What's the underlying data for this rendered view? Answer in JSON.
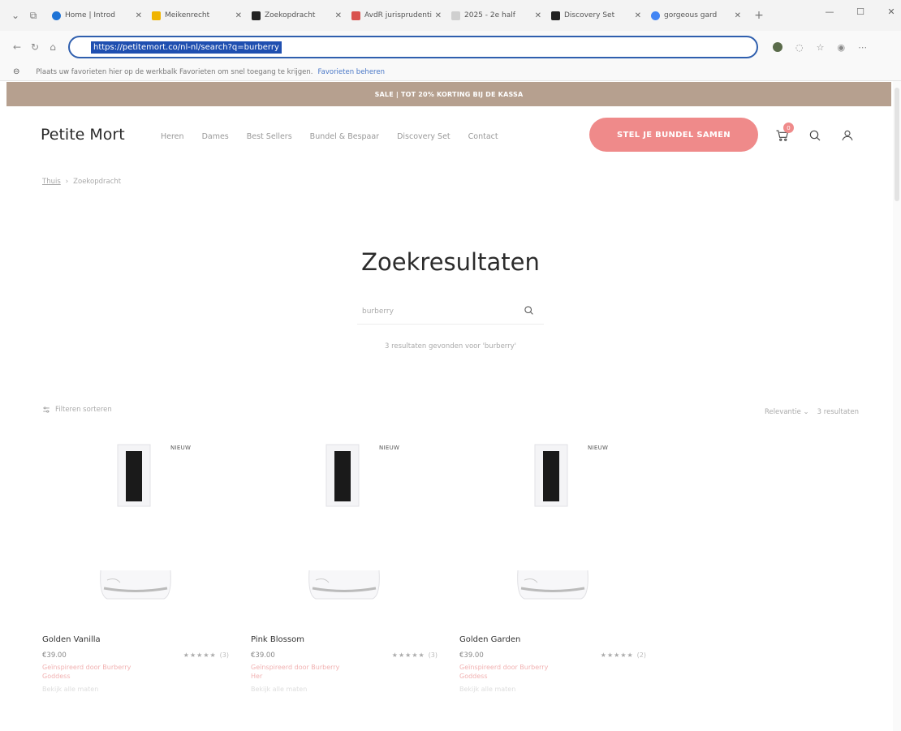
{
  "browser": {
    "tabs": [
      {
        "title": "Home | Introd",
        "color": "#1e73d6"
      },
      {
        "title": "Meikenrecht",
        "color": "#f0b400"
      },
      {
        "title": "Zoekopdracht",
        "color": "#222222"
      },
      {
        "title": "AvdR jurisprudentie",
        "color": "#d9534f"
      },
      {
        "title": "2025 - 2e half",
        "color": "#cfcfcf"
      },
      {
        "title": "Discovery Set",
        "color": "#222222"
      },
      {
        "title": "gorgeous gard",
        "color": "#4285f4"
      }
    ],
    "url": "https://petitemort.co/nl-nl/search?q=burberry",
    "favorites_bar_text": "Plaats uw favorieten hier op de werkbalk Favorieten om snel toegang te krijgen.",
    "favorites_bar_link": "Favorieten beheren"
  },
  "site": {
    "promo": "SALE | TOT 20% KORTING BIJ DE KASSA",
    "logo": "Petite Mort",
    "nav": [
      "Heren",
      "Dames",
      "Best Sellers",
      "Bundel & Bespaar",
      "Discovery Set",
      "Contact"
    ],
    "cta": "STEL JE BUNDEL SAMEN",
    "cart_count": "0",
    "breadcrumb": {
      "home": "Thuis",
      "current": "Zoekopdracht"
    },
    "page_title": "Zoekresultaten",
    "search": {
      "value": "burberry"
    },
    "result_text": "3 resultaten gevonden voor 'burberry'",
    "filter_label": "Filteren sorteren",
    "sort_label": "Relevantie",
    "results_label": "3 resultaten",
    "products": [
      {
        "badge": "NIEUW",
        "name": "Golden Vanilla",
        "price": "€39.00",
        "stars": "★★★★★",
        "reviews": "(3)",
        "desc": "Geïnspireerd door Burberry Goddess",
        "extra": "Bekijk alle maten"
      },
      {
        "badge": "NIEUW",
        "name": "Pink Blossom",
        "price": "€39.00",
        "stars": "★★★★★",
        "reviews": "(3)",
        "desc": "Geïnspireerd door Burberry Her",
        "extra": "Bekijk alle maten"
      },
      {
        "badge": "NIEUW",
        "name": "Golden Garden",
        "price": "€39.00",
        "stars": "★★★★★",
        "reviews": "(2)",
        "desc": "Geïnspireerd door Burberry Goddess",
        "extra": "Bekijk alle maten"
      }
    ]
  },
  "colors": {
    "promo": "#b6a08f",
    "cta": "#ef8a8a",
    "url_highlight": "#1f4fb0",
    "desc_pink": "#f1b2b2"
  }
}
